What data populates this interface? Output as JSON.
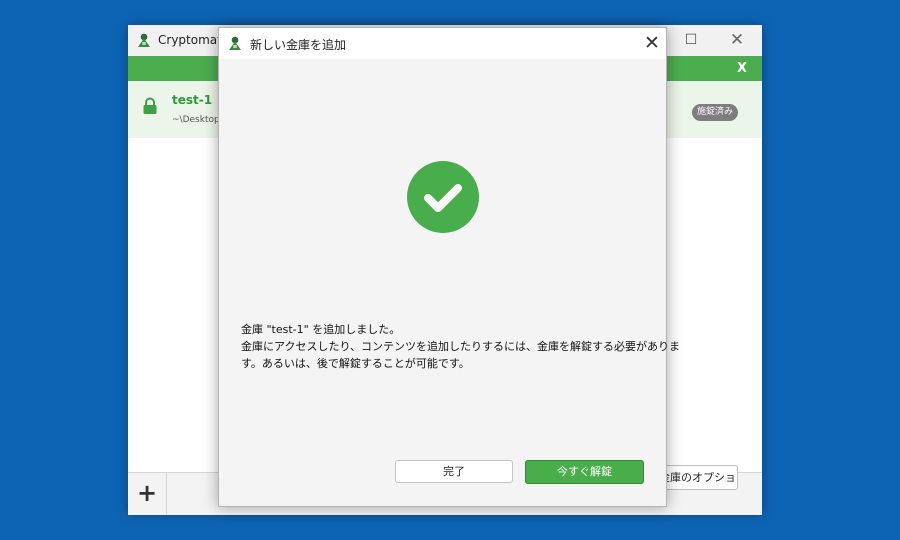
{
  "main_window": {
    "title": "Cryptomato",
    "maximize_glyph": "☐",
    "close_glyph": "✕",
    "banner_close": "X",
    "vault": {
      "name": "test-1",
      "path": "~\\Desktop",
      "status": "施錠済み"
    },
    "add_button": "+",
    "options_button": "金庫のオプション"
  },
  "dialog": {
    "title": "新しい金庫を追加",
    "close_glyph": "✕",
    "message_lines": [
      "金庫 \"test-1\" を追加しました。",
      "金庫にアクセスしたり、コンテンツを追加したりするには、金庫を解錠する必要がありま",
      "す。あるいは、後で解錠することが可能です。"
    ],
    "done_button": "完了",
    "unlock_button": "今すぐ解錠"
  },
  "colors": {
    "desktop": "#0e64b4",
    "accent_green": "#49ad4c",
    "badge_gray": "#7e7e7e"
  },
  "icons": {
    "app": "cryptomator-logo-icon",
    "lock": "lock-icon",
    "success": "checkmark-circle-icon"
  }
}
